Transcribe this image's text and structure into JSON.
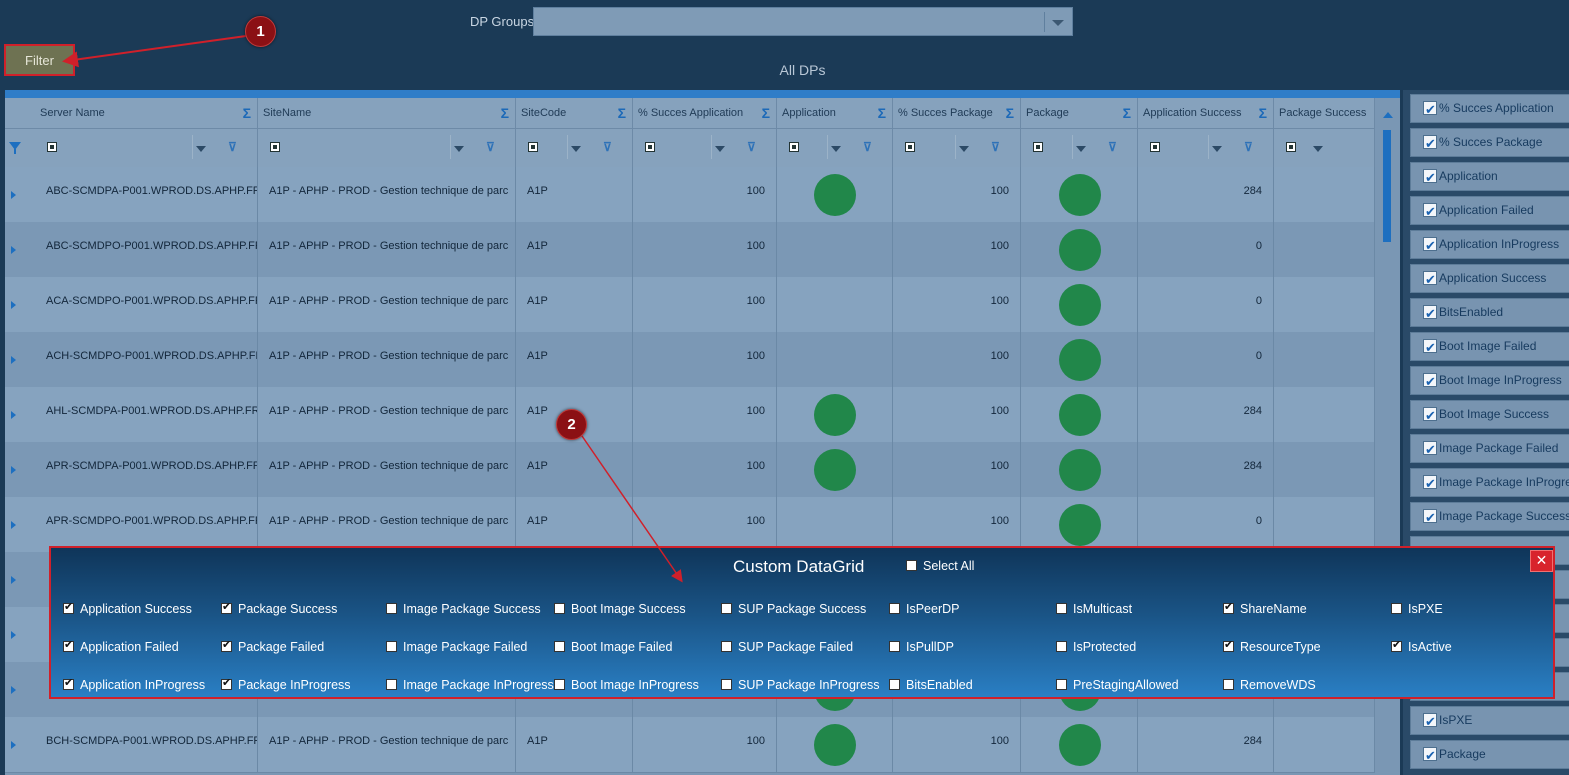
{
  "top": {
    "dp_groups_label": "DP Groups",
    "filter_label": "Filter",
    "grid_title": "All DPs"
  },
  "annotations": {
    "badge1": "1",
    "badge2": "2",
    "color": "#d0202a"
  },
  "grid": {
    "columns": [
      "Server Name",
      "SiteName",
      "SiteCode",
      "% Succes Application",
      "Application",
      "% Succes Package",
      "Package",
      "Application Success",
      "Package Success"
    ],
    "sigma": "Σ",
    "clear_filter": "▼x",
    "status_color": "#21874a",
    "rows": [
      {
        "server": "ABC-SCMDPA-P001.WPROD.DS.APHP.FR",
        "site": "A1P - APHP - PROD - Gestion technique de parc",
        "code": "A1P",
        "pct_app": "100",
        "app": true,
        "pct_pkg": "100",
        "pkg": true,
        "app_success": "284"
      },
      {
        "server": "ABC-SCMDPO-P001.WPROD.DS.APHP.FR",
        "site": "A1P - APHP - PROD - Gestion technique de parc",
        "code": "A1P",
        "pct_app": "100",
        "app": false,
        "pct_pkg": "100",
        "pkg": true,
        "app_success": "0"
      },
      {
        "server": "ACA-SCMDPO-P001.WPROD.DS.APHP.FR",
        "site": "A1P - APHP - PROD - Gestion technique de parc",
        "code": "A1P",
        "pct_app": "100",
        "app": false,
        "pct_pkg": "100",
        "pkg": true,
        "app_success": "0"
      },
      {
        "server": "ACH-SCMDPO-P001.WPROD.DS.APHP.FR",
        "site": "A1P - APHP - PROD - Gestion technique de parc",
        "code": "A1P",
        "pct_app": "100",
        "app": false,
        "pct_pkg": "100",
        "pkg": true,
        "app_success": "0"
      },
      {
        "server": "AHL-SCMDPA-P001.WPROD.DS.APHP.FR",
        "site": "A1P - APHP - PROD - Gestion technique de parc",
        "code": "A1P",
        "pct_app": "100",
        "app": true,
        "pct_pkg": "100",
        "pkg": true,
        "app_success": "284"
      },
      {
        "server": "APR-SCMDPA-P001.WPROD.DS.APHP.FR",
        "site": "A1P - APHP - PROD - Gestion technique de parc",
        "code": "A1P",
        "pct_app": "100",
        "app": true,
        "pct_pkg": "100",
        "pkg": true,
        "app_success": "284"
      },
      {
        "server": "APR-SCMDPO-P001.WPROD.DS.APHP.FR",
        "site": "A1P - APHP - PROD - Gestion technique de parc",
        "code": "A1P",
        "pct_app": "100",
        "app": false,
        "pct_pkg": "100",
        "pkg": true,
        "app_success": "0"
      },
      {
        "server": "",
        "site": "",
        "code": "",
        "pct_app": "",
        "app": false,
        "pct_pkg": "",
        "pkg": false,
        "app_success": ""
      },
      {
        "server": "",
        "site": "",
        "code": "",
        "pct_app": "",
        "app": false,
        "pct_pkg": "",
        "pkg": false,
        "app_success": ""
      },
      {
        "server": "",
        "site": "",
        "code": "",
        "pct_app": "",
        "app": true,
        "pct_pkg": "",
        "pkg": true,
        "app_success": ""
      },
      {
        "server": "BCH-SCMDPA-P001.WPROD.DS.APHP.FR",
        "site": "A1P - APHP - PROD - Gestion technique de parc",
        "code": "A1P",
        "pct_app": "100",
        "app": true,
        "pct_pkg": "100",
        "pkg": true,
        "app_success": "284"
      }
    ]
  },
  "sidebar": {
    "items": [
      "% Succes Application",
      "% Succes Package",
      "Application",
      "Application Failed",
      "Application InProgress",
      "Application Success",
      "BitsEnabled",
      "Boot Image Failed",
      "Boot Image InProgress",
      "Boot Image Success",
      "Image Package Failed",
      "Image Package InProgress",
      "Image Package Success"
    ],
    "bottom_items": [
      "IsPXE",
      "Package"
    ]
  },
  "panel": {
    "title": "Custom DataGrid",
    "select_all": "Select All",
    "close": "✕",
    "options": [
      {
        "label": "Application Success",
        "checked": true
      },
      {
        "label": "Package Success",
        "checked": true
      },
      {
        "label": "Image Package Success",
        "checked": false
      },
      {
        "label": "Boot Image Success",
        "checked": false
      },
      {
        "label": "SUP Package Success",
        "checked": false
      },
      {
        "label": "IsPeerDP",
        "checked": false
      },
      {
        "label": "IsMulticast",
        "checked": false
      },
      {
        "label": "ShareName",
        "checked": true
      },
      {
        "label": "IsPXE",
        "checked": false
      },
      {
        "label": "Application Failed",
        "checked": true
      },
      {
        "label": "Package Failed",
        "checked": true
      },
      {
        "label": "Image Package Failed",
        "checked": false
      },
      {
        "label": "Boot Image Failed",
        "checked": false
      },
      {
        "label": "SUP Package Failed",
        "checked": false
      },
      {
        "label": "IsPullDP",
        "checked": false
      },
      {
        "label": "IsProtected",
        "checked": false
      },
      {
        "label": "ResourceType",
        "checked": true
      },
      {
        "label": "IsActive",
        "checked": true
      },
      {
        "label": "Application InProgress",
        "checked": true
      },
      {
        "label": "Package InProgress",
        "checked": true
      },
      {
        "label": "Image Package InProgress",
        "checked": false
      },
      {
        "label": "Boot Image InProgress",
        "checked": false
      },
      {
        "label": "SUP Package InProgress",
        "checked": false
      },
      {
        "label": "BitsEnabled",
        "checked": false
      },
      {
        "label": "PreStagingAllowed",
        "checked": false
      },
      {
        "label": "RemoveWDS",
        "checked": false
      }
    ]
  }
}
